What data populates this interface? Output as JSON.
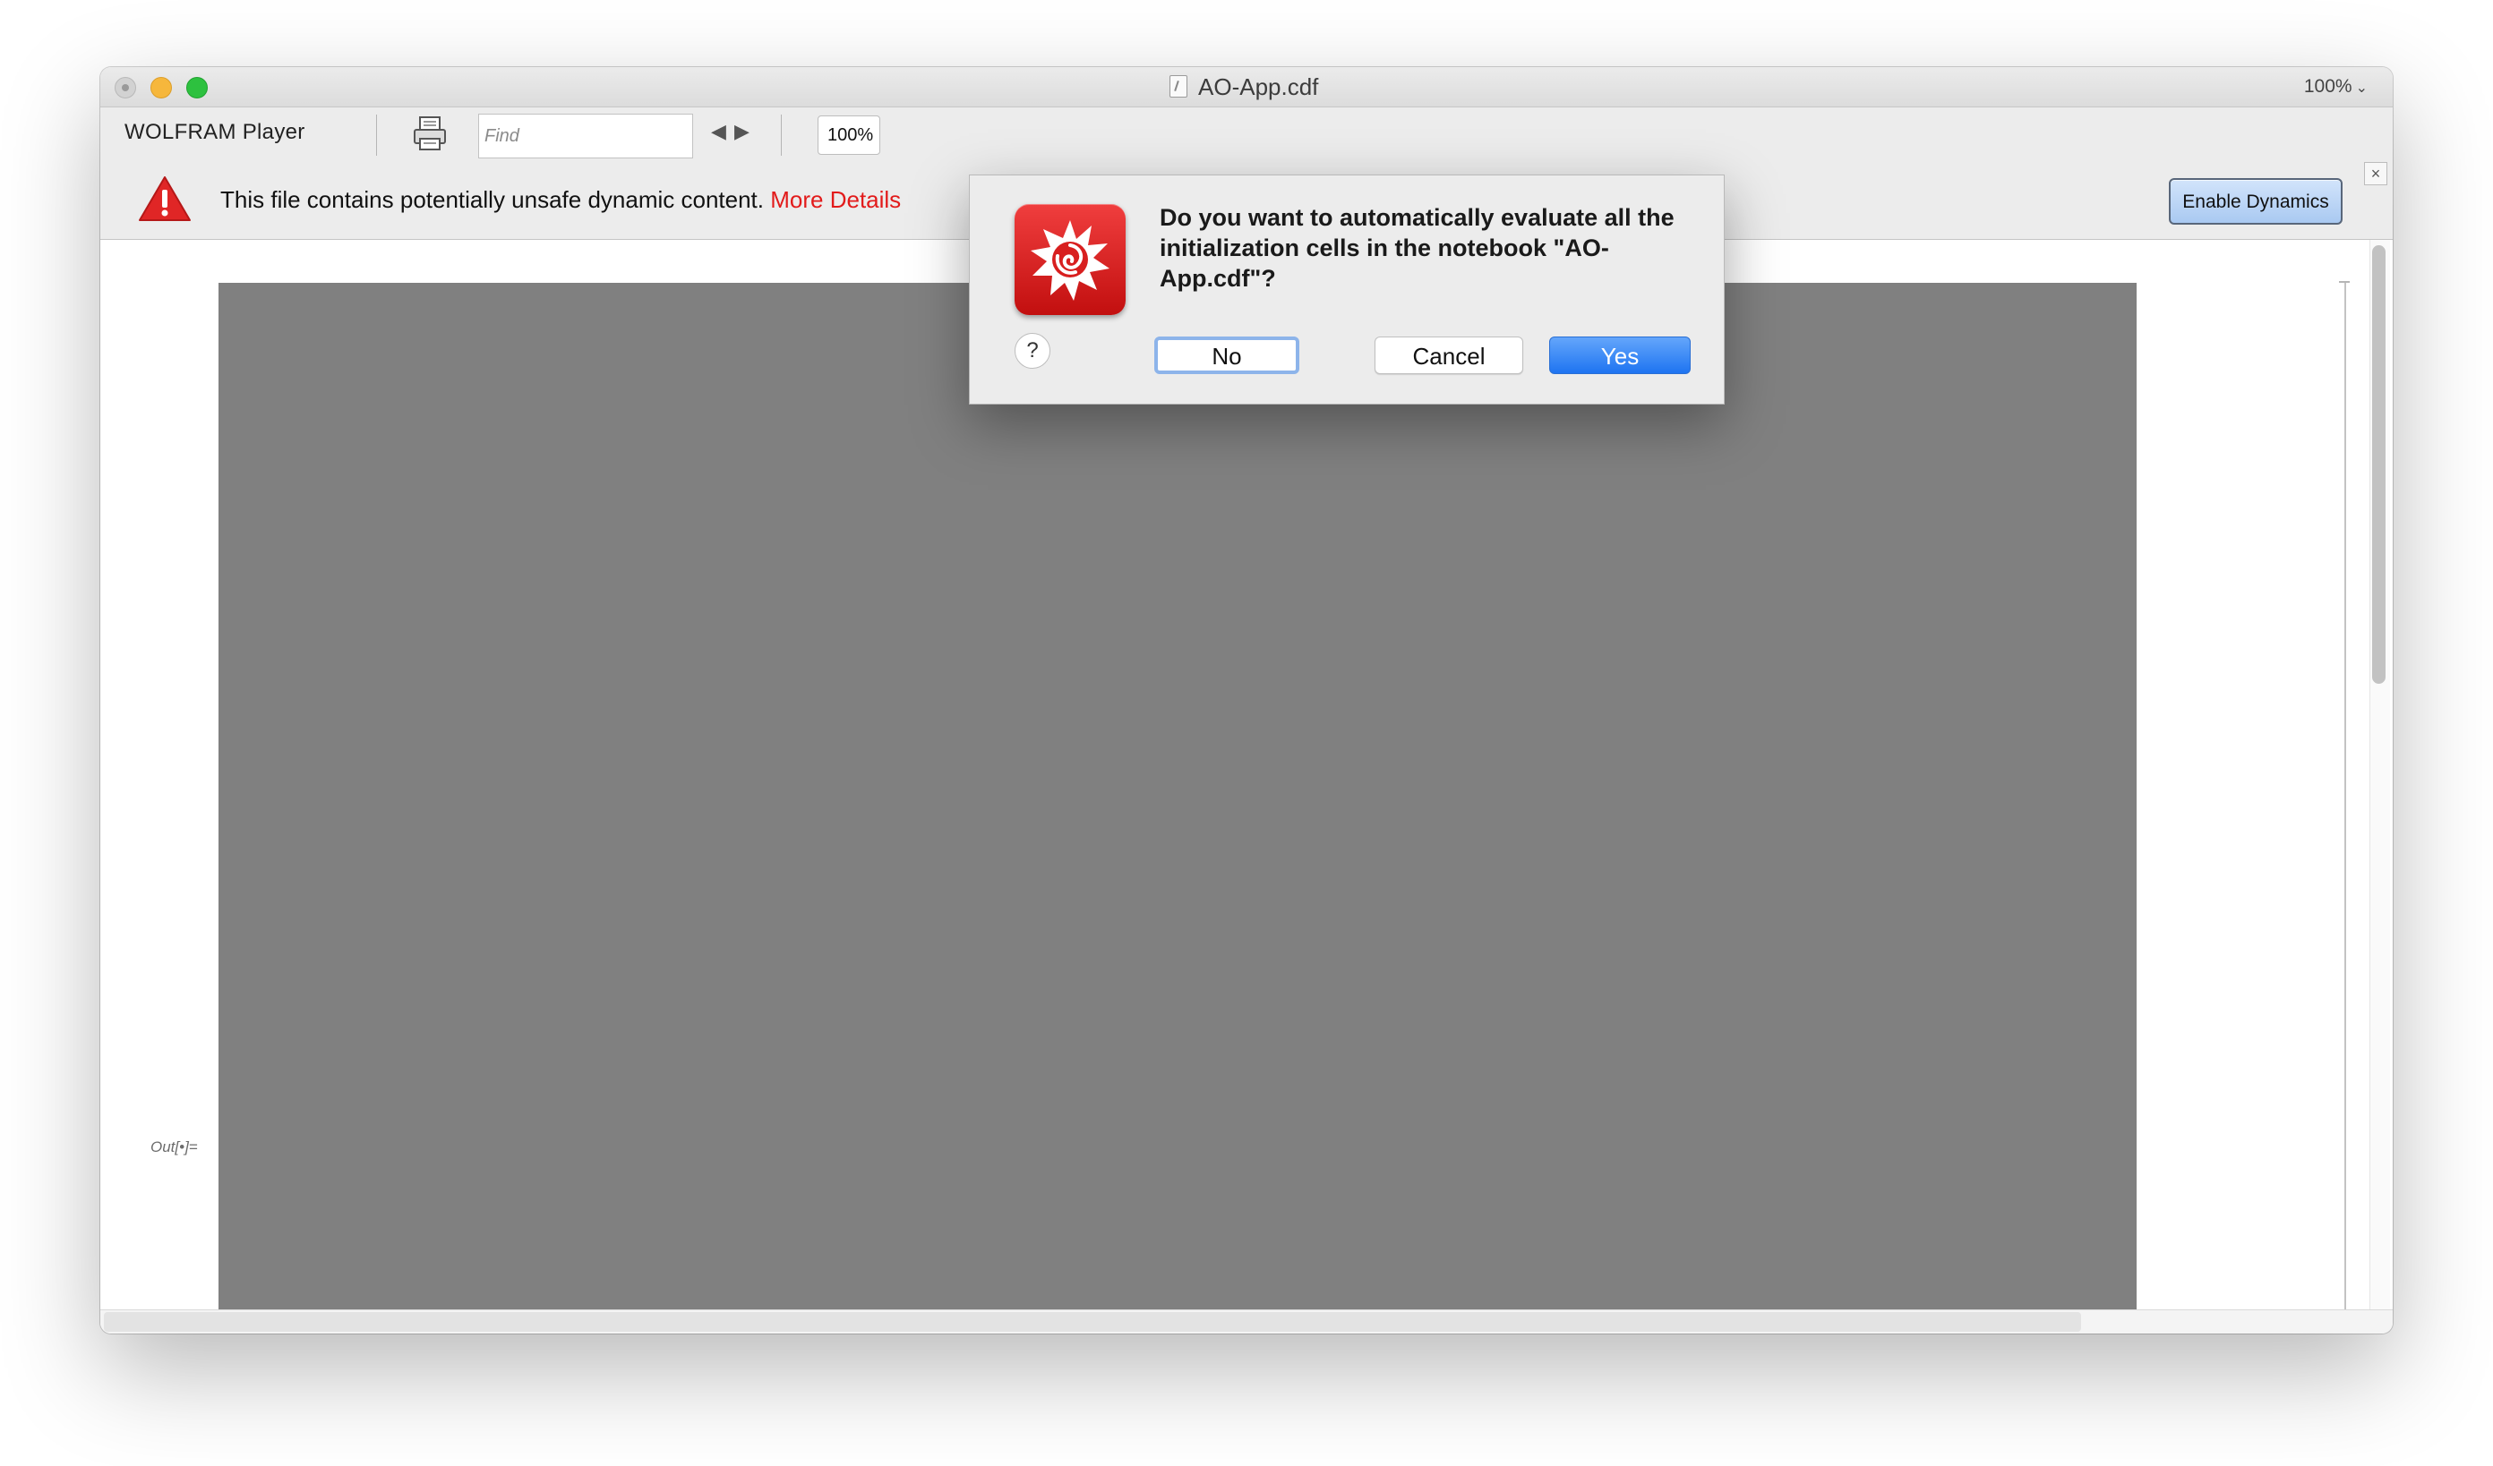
{
  "window": {
    "title": "AO-App.cdf",
    "zoom_label": "100%"
  },
  "toolbar": {
    "brand": "WOLFRAM Player",
    "find_placeholder": "Find",
    "zoom_value": "100%"
  },
  "warning_bar": {
    "message": "This file contains potentially unsafe dynamic content.",
    "link_text": "More Details",
    "enable_button": "Enable Dynamics",
    "close_glyph": "×"
  },
  "notebook": {
    "output_label": "Out[•]="
  },
  "dialog": {
    "message": "Do you want to automatically evaluate all the initialization cells in the notebook \"AO-App.cdf\"?",
    "help_glyph": "?",
    "buttons": {
      "no": "No",
      "cancel": "Cancel",
      "yes": "Yes"
    }
  },
  "icons": [
    "window-close-icon",
    "window-minimize-icon",
    "window-zoom-icon",
    "document-icon",
    "print-icon",
    "find-previous-icon",
    "find-next-icon",
    "warning-icon",
    "close-icon",
    "wolfram-spikey-icon",
    "help-icon"
  ],
  "colors": {
    "accent_blue": "#1e74f1",
    "warning_red": "#e21b1b",
    "output_gray": "#808080"
  }
}
